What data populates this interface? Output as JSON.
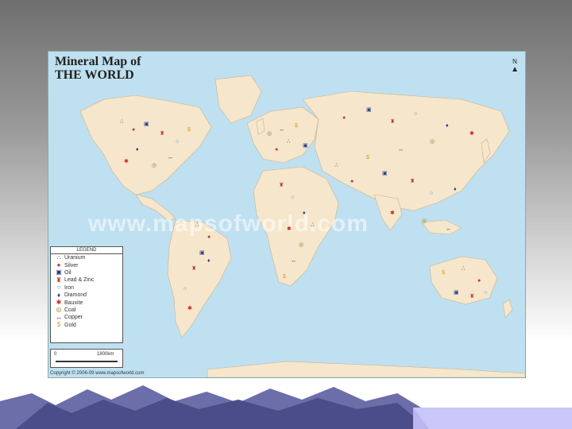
{
  "map": {
    "title_line1": "Mineral Map of",
    "title_line2": "THE WORLD",
    "north_label": "N",
    "watermark": "www.mapsofworld.com",
    "copyright": "Copyright © 2006-09 www.mapsofworld.com",
    "legend": {
      "title": "LEGEND",
      "items": [
        {
          "label": "Uranium",
          "symbol": "∴",
          "color": "#444444",
          "icon": "uranium-icon"
        },
        {
          "label": "Silver",
          "symbol": "●",
          "color": "#c0392b",
          "icon": "silver-icon"
        },
        {
          "label": "Oil",
          "symbol": "▣",
          "color": "#2b3a8f",
          "icon": "oil-icon"
        },
        {
          "label": "Lead & Zinc",
          "symbol": "♜",
          "color": "#c0392b",
          "icon": "lead-zinc-icon"
        },
        {
          "label": "Iron",
          "symbol": "○",
          "color": "#2a8ad4",
          "icon": "iron-icon"
        },
        {
          "label": "Diamond",
          "symbol": "♦",
          "color": "#2b3a8f",
          "icon": "diamond-icon"
        },
        {
          "label": "Bauxite",
          "symbol": "✱",
          "color": "#d02020",
          "icon": "bauxite-icon"
        },
        {
          "label": "Coal",
          "symbol": "◎",
          "color": "#9a7a20",
          "icon": "coal-icon"
        },
        {
          "label": "Copper",
          "symbol": "↔",
          "color": "#333333",
          "icon": "copper-icon"
        },
        {
          "label": "Gold",
          "symbol": "$",
          "color": "#d4a017",
          "icon": "gold-icon"
        }
      ]
    },
    "scale": {
      "start": "0",
      "end": "1800km"
    }
  }
}
